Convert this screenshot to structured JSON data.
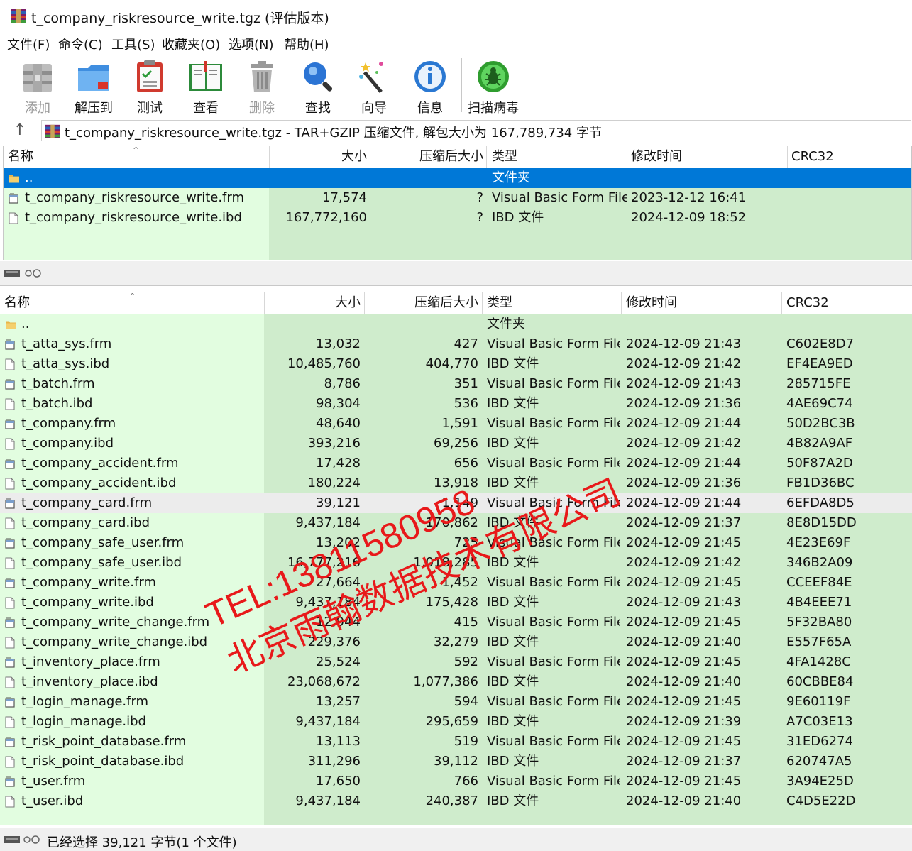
{
  "window": {
    "title": "t_company_riskresource_write.tgz (评估版本)"
  },
  "menu": [
    "文件(F)",
    "命令(C)",
    "工具(S)",
    "收藏夹(O)",
    "选项(N)",
    "帮助(H)"
  ],
  "toolbar": {
    "add": "添加",
    "extract": "解压到",
    "test": "测试",
    "view": "查看",
    "delete": "删除",
    "find": "查找",
    "wizard": "向导",
    "info": "信息",
    "scan": "扫描病毒"
  },
  "address": {
    "text": "t_company_riskresource_write.tgz - TAR+GZIP 压缩文件, 解包大小为 167,789,734 字节"
  },
  "columns": {
    "name": "名称",
    "size": "大小",
    "packed": "压缩后大小",
    "type": "类型",
    "modified": "修改时间",
    "crc": "CRC32"
  },
  "top_pane": {
    "rows": [
      {
        "name": "..",
        "size": "",
        "packed": "",
        "type": "文件夹",
        "modified": "",
        "crc": "",
        "kind": "folder",
        "selected": true
      },
      {
        "name": "t_company_riskresource_write.frm",
        "size": "17,574",
        "packed": "?",
        "type": "Visual Basic Form File",
        "modified": "2023-12-12 16:41",
        "crc": "",
        "kind": "frm"
      },
      {
        "name": "t_company_riskresource_write.ibd",
        "size": "167,772,160",
        "packed": "?",
        "type": "IBD 文件",
        "modified": "2024-12-09 18:52",
        "crc": "",
        "kind": "ibd"
      }
    ]
  },
  "bottom_pane": {
    "rows": [
      {
        "name": "..",
        "size": "",
        "packed": "",
        "type": "文件夹",
        "modified": "",
        "crc": "",
        "kind": "folder"
      },
      {
        "name": "t_atta_sys.frm",
        "size": "13,032",
        "packed": "427",
        "type": "Visual Basic Form File",
        "modified": "2024-12-09 21:43",
        "crc": "C602E8D7",
        "kind": "frm"
      },
      {
        "name": "t_atta_sys.ibd",
        "size": "10,485,760",
        "packed": "404,770",
        "type": "IBD 文件",
        "modified": "2024-12-09 21:42",
        "crc": "EF4EA9ED",
        "kind": "ibd"
      },
      {
        "name": "t_batch.frm",
        "size": "8,786",
        "packed": "351",
        "type": "Visual Basic Form File",
        "modified": "2024-12-09 21:43",
        "crc": "285715FE",
        "kind": "frm"
      },
      {
        "name": "t_batch.ibd",
        "size": "98,304",
        "packed": "536",
        "type": "IBD 文件",
        "modified": "2024-12-09 21:36",
        "crc": "4AE69C74",
        "kind": "ibd"
      },
      {
        "name": "t_company.frm",
        "size": "48,640",
        "packed": "1,591",
        "type": "Visual Basic Form File",
        "modified": "2024-12-09 21:44",
        "crc": "50D2BC3B",
        "kind": "frm"
      },
      {
        "name": "t_company.ibd",
        "size": "393,216",
        "packed": "69,256",
        "type": "IBD 文件",
        "modified": "2024-12-09 21:42",
        "crc": "4B82A9AF",
        "kind": "ibd"
      },
      {
        "name": "t_company_accident.frm",
        "size": "17,428",
        "packed": "656",
        "type": "Visual Basic Form File",
        "modified": "2024-12-09 21:44",
        "crc": "50F87A2D",
        "kind": "frm"
      },
      {
        "name": "t_company_accident.ibd",
        "size": "180,224",
        "packed": "13,918",
        "type": "IBD 文件",
        "modified": "2024-12-09 21:36",
        "crc": "FB1D36BC",
        "kind": "ibd"
      },
      {
        "name": "t_company_card.frm",
        "size": "39,121",
        "packed": "1,149",
        "type": "Visual Basic Form File",
        "modified": "2024-12-09 21:44",
        "crc": "6EFDA8D5",
        "kind": "frm",
        "highlight": true
      },
      {
        "name": "t_company_card.ibd",
        "size": "9,437,184",
        "packed": "170,862",
        "type": "IBD 文件",
        "modified": "2024-12-09 21:37",
        "crc": "8E8D15DD",
        "kind": "ibd"
      },
      {
        "name": "t_company_safe_user.frm",
        "size": "13,202",
        "packed": "725",
        "type": "Visual Basic Form File",
        "modified": "2024-12-09 21:45",
        "crc": "4E23E69F",
        "kind": "frm"
      },
      {
        "name": "t_company_safe_user.ibd",
        "size": "16,777,216",
        "packed": "1,018,285",
        "type": "IBD 文件",
        "modified": "2024-12-09 21:42",
        "crc": "346B2A09",
        "kind": "ibd"
      },
      {
        "name": "t_company_write.frm",
        "size": "27,664",
        "packed": "1,452",
        "type": "Visual Basic Form File",
        "modified": "2024-12-09 21:45",
        "crc": "CCEEF84E",
        "kind": "frm"
      },
      {
        "name": "t_company_write.ibd",
        "size": "9,437,184",
        "packed": "175,428",
        "type": "IBD 文件",
        "modified": "2024-12-09 21:43",
        "crc": "4B4EEE71",
        "kind": "ibd"
      },
      {
        "name": "t_company_write_change.frm",
        "size": "12,944",
        "packed": "415",
        "type": "Visual Basic Form File",
        "modified": "2024-12-09 21:45",
        "crc": "5F32BA80",
        "kind": "frm"
      },
      {
        "name": "t_company_write_change.ibd",
        "size": "229,376",
        "packed": "32,279",
        "type": "IBD 文件",
        "modified": "2024-12-09 21:40",
        "crc": "E557F65A",
        "kind": "ibd"
      },
      {
        "name": "t_inventory_place.frm",
        "size": "25,524",
        "packed": "592",
        "type": "Visual Basic Form File",
        "modified": "2024-12-09 21:45",
        "crc": "4FA1428C",
        "kind": "frm"
      },
      {
        "name": "t_inventory_place.ibd",
        "size": "23,068,672",
        "packed": "1,077,386",
        "type": "IBD 文件",
        "modified": "2024-12-09 21:40",
        "crc": "60CBBE84",
        "kind": "ibd"
      },
      {
        "name": "t_login_manage.frm",
        "size": "13,257",
        "packed": "594",
        "type": "Visual Basic Form File",
        "modified": "2024-12-09 21:45",
        "crc": "9E60119F",
        "kind": "frm"
      },
      {
        "name": "t_login_manage.ibd",
        "size": "9,437,184",
        "packed": "295,659",
        "type": "IBD 文件",
        "modified": "2024-12-09 21:39",
        "crc": "A7C03E13",
        "kind": "ibd"
      },
      {
        "name": "t_risk_point_database.frm",
        "size": "13,113",
        "packed": "519",
        "type": "Visual Basic Form File",
        "modified": "2024-12-09 21:45",
        "crc": "31ED6274",
        "kind": "frm"
      },
      {
        "name": "t_risk_point_database.ibd",
        "size": "311,296",
        "packed": "39,112",
        "type": "IBD 文件",
        "modified": "2024-12-09 21:37",
        "crc": "620747A5",
        "kind": "ibd"
      },
      {
        "name": "t_user.frm",
        "size": "17,650",
        "packed": "766",
        "type": "Visual Basic Form File",
        "modified": "2024-12-09 21:45",
        "crc": "3A94E25D",
        "kind": "frm"
      },
      {
        "name": "t_user.ibd",
        "size": "9,437,184",
        "packed": "240,387",
        "type": "IBD 文件",
        "modified": "2024-12-09 21:40",
        "crc": "C4D5E22D",
        "kind": "ibd"
      }
    ]
  },
  "status": {
    "text": "已经选择 39,121 字节(1 个文件)"
  },
  "watermark": {
    "line1": "TEL:13811580958",
    "line2": "北京雨翰数据技术有限公司",
    "color": "#e8191a"
  },
  "colors": {
    "name_col": "#e2fde0",
    "other_cols": "#cfeccc",
    "selection": "#0078d7"
  }
}
